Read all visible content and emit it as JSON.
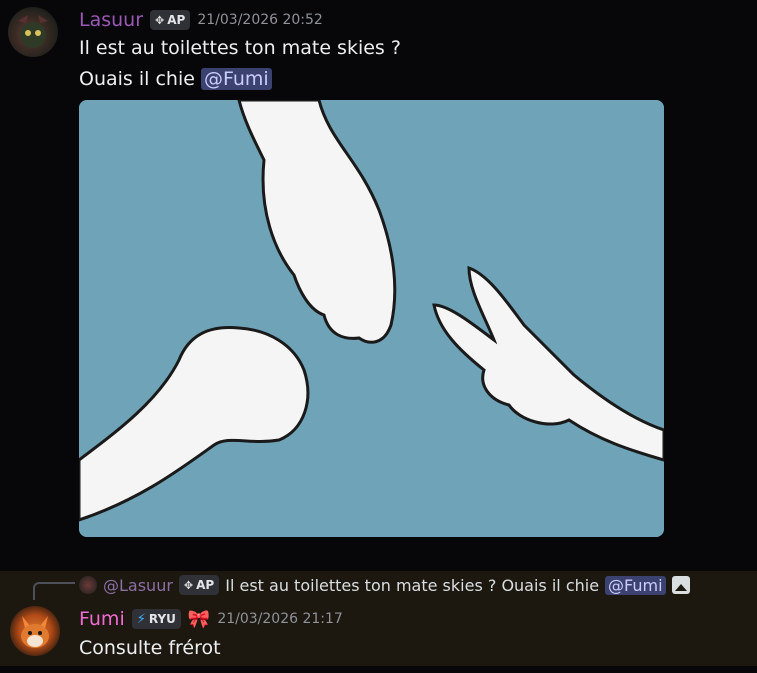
{
  "message1": {
    "author": "Lasuur",
    "tag": "AP",
    "timestamp": "21/03/2026 20:52",
    "line1": "Il est au toilettes ton mate skies ?",
    "line2_prefix": "Ouais il chie ",
    "mention": "@Fumi",
    "image_alt": "Rock paper scissors hands illustration"
  },
  "message2": {
    "reply": {
      "author": "@Lasuur",
      "tag": "AP",
      "text": "Il est au toilettes ton mate skies ? Ouais il chie ",
      "mention": "@Fumi"
    },
    "author": "Fumi",
    "tag": "RYU",
    "timestamp": "21/03/2026 21:17",
    "text": "Consulte frérot"
  },
  "colors": {
    "background": "#070709",
    "highlight": "#1c1810",
    "mention_bg": "#3c4270",
    "lasuur": "#9b59b6",
    "fumi": "#f06bd2"
  },
  "icons": {
    "tag1": "diamond-icon",
    "tag2": "bolt-icon",
    "role": "bow-icon",
    "attachment": "image-icon"
  }
}
